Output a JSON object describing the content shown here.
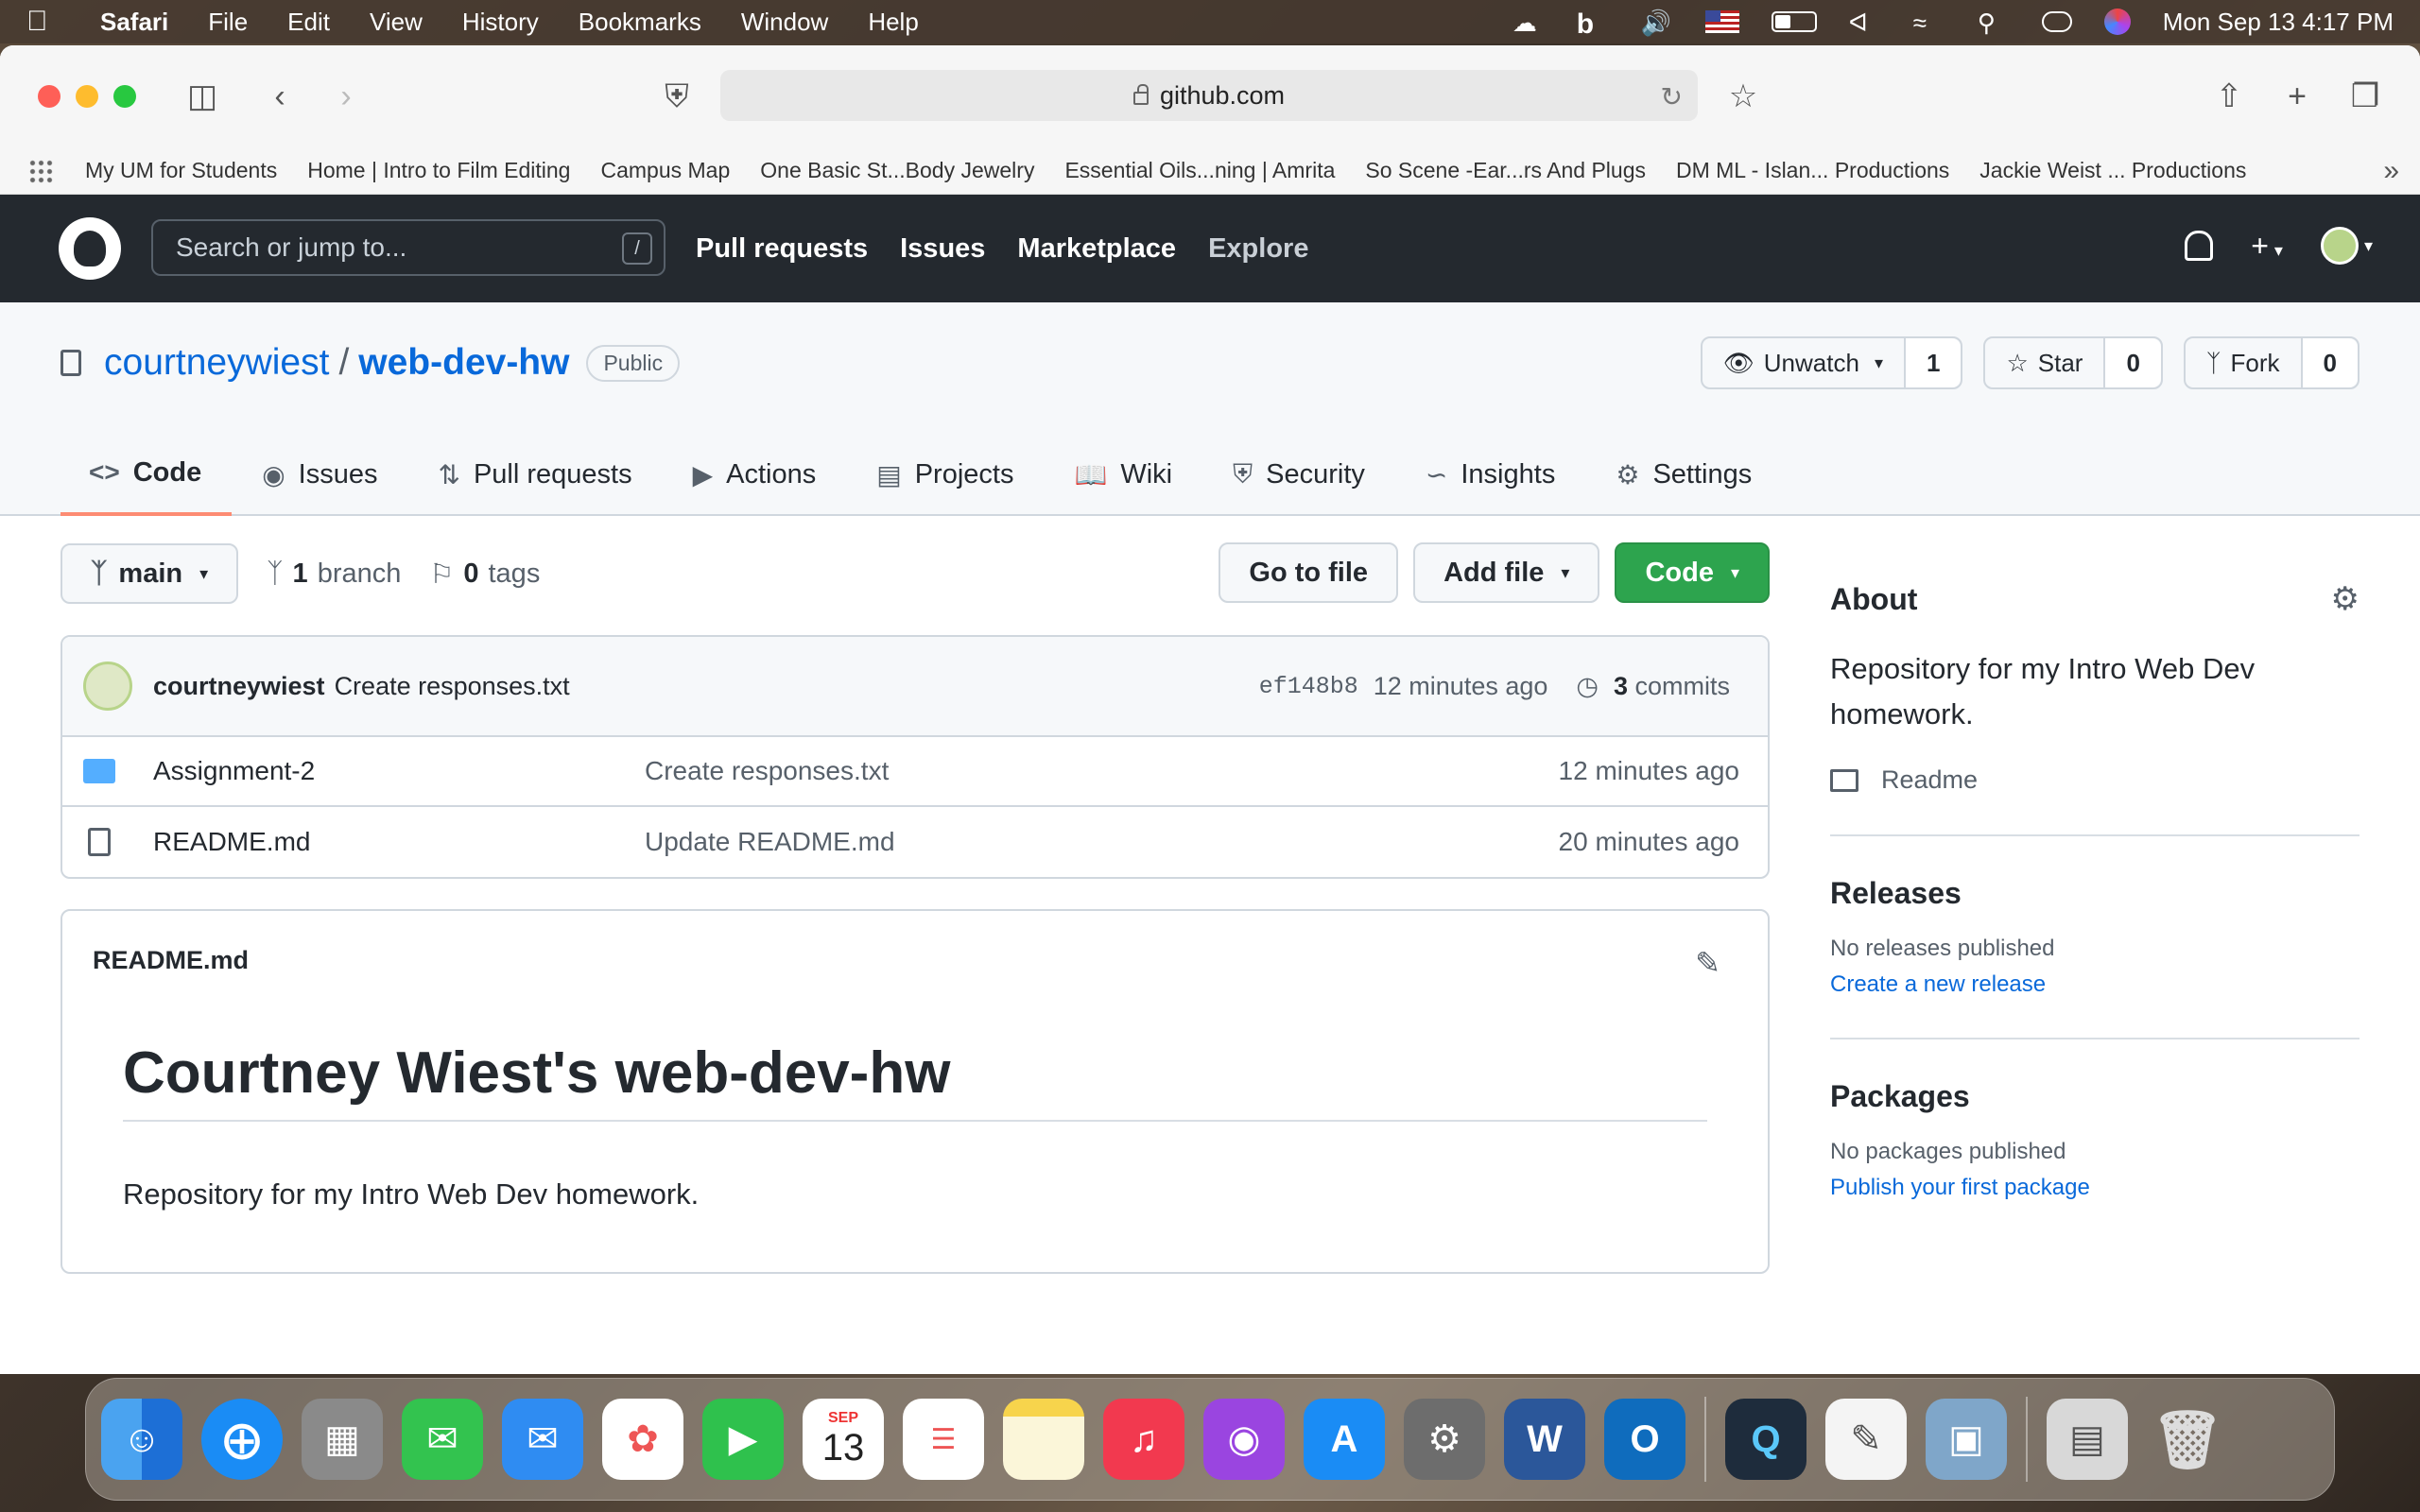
{
  "menubar": {
    "app": "Safari",
    "items": [
      "File",
      "Edit",
      "View",
      "History",
      "Bookmarks",
      "Window",
      "Help"
    ],
    "clock": "Mon Sep 13  4:17 PM"
  },
  "browser": {
    "url": "github.com",
    "bookmarks": [
      "My UM for Students",
      "Home | Intro to Film Editing",
      "Campus Map",
      "One Basic St...Body Jewelry",
      "Essential Oils...ning | Amrita",
      "So Scene -Ear...rs And Plugs",
      "DM ML - Islan... Productions",
      "Jackie Weist ... Productions"
    ]
  },
  "github": {
    "search_placeholder": "Search or jump to...",
    "search_key": "/",
    "nav": [
      "Pull requests",
      "Issues",
      "Marketplace",
      "Explore"
    ]
  },
  "repo": {
    "owner": "courtneywiest",
    "sep": "/",
    "name": "web-dev-hw",
    "visibility": "Public",
    "watch_label": "Unwatch",
    "watch_count": "1",
    "star_label": "Star",
    "star_count": "0",
    "fork_label": "Fork",
    "fork_count": "0",
    "tabs": [
      "Code",
      "Issues",
      "Pull requests",
      "Actions",
      "Projects",
      "Wiki",
      "Security",
      "Insights",
      "Settings"
    ]
  },
  "files": {
    "branch": "main",
    "branch_count": "1",
    "branch_word": "branch",
    "tag_count": "0",
    "tag_word": "tags",
    "go_to_file": "Go to file",
    "add_file": "Add file",
    "code": "Code",
    "commit": {
      "author": "courtneywiest",
      "message": "Create responses.txt",
      "sha": "ef148b8",
      "time": "12 minutes ago",
      "commit_count": "3",
      "commit_word": "commits"
    },
    "rows": [
      {
        "name": "Assignment-2",
        "message": "Create responses.txt",
        "age": "12 minutes ago"
      },
      {
        "name": "README.md",
        "message": "Update README.md",
        "age": "20 minutes ago"
      }
    ]
  },
  "readme": {
    "filename": "README.md",
    "heading": "Courtney Wiest's web-dev-hw",
    "body": "Repository for my Intro Web Dev homework."
  },
  "sidebar": {
    "about_title": "About",
    "about_desc": "Repository for my Intro Web Dev homework.",
    "readme_link": "Readme",
    "releases_title": "Releases",
    "releases_none": "No releases published",
    "releases_link": "Create a new release",
    "packages_title": "Packages",
    "packages_none": "No packages published",
    "packages_link": "Publish your first package"
  },
  "dock": {
    "calendar_month": "SEP",
    "calendar_day": "13"
  }
}
